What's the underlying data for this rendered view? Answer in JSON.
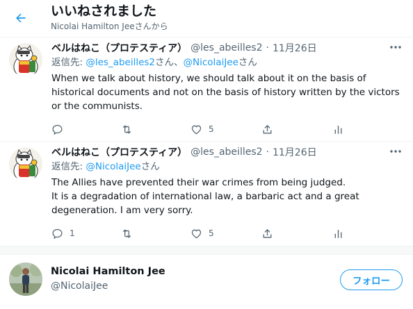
{
  "header": {
    "title": "いいねされました",
    "subtitle": "Nicolai Hamilton Jeeさんから"
  },
  "tweets": [
    {
      "name": "ベルはねこ（プロテスティア）",
      "handle": "@les_abeilles2",
      "dot": "·",
      "date": "11月26日",
      "reply_prefix": "返信先: ",
      "reply_links": [
        "@les_abeilles2",
        "@NicolaiJee"
      ],
      "reply_sep": "さん、",
      "reply_suffix": "さん",
      "text_lines": [
        "When we talk about history, we should talk about it on the basis of historical documents and not on the basis of history written by the victors or the communists."
      ],
      "reply_count": "",
      "retweet_count": "",
      "like_count": "5"
    },
    {
      "name": "ベルはねこ（プロテスティア）",
      "handle": "@les_abeilles2",
      "dot": "·",
      "date": "11月26日",
      "reply_prefix": "返信先: ",
      "reply_links": [
        "@NicolaiJee"
      ],
      "reply_suffix": "さん",
      "text_lines": [
        "The Allies have prevented their war crimes from being judged.",
        "It is a degradation of international law, a barbaric act and a great degeneration. I am very sorry."
      ],
      "reply_count": "1",
      "retweet_count": "",
      "like_count": "5"
    }
  ],
  "user": {
    "name": "Nicolai Hamilton Jee",
    "handle": "@NicolaiJee",
    "follow_label": "フォロー"
  },
  "colors": {
    "accent": "#1d9bf0",
    "text": "#0f1419",
    "secondary": "#536471",
    "border": "#eff3f4"
  },
  "icons": [
    "back-arrow-icon",
    "more-icon",
    "reply-icon",
    "retweet-icon",
    "like-icon",
    "share-icon",
    "analytics-icon"
  ]
}
